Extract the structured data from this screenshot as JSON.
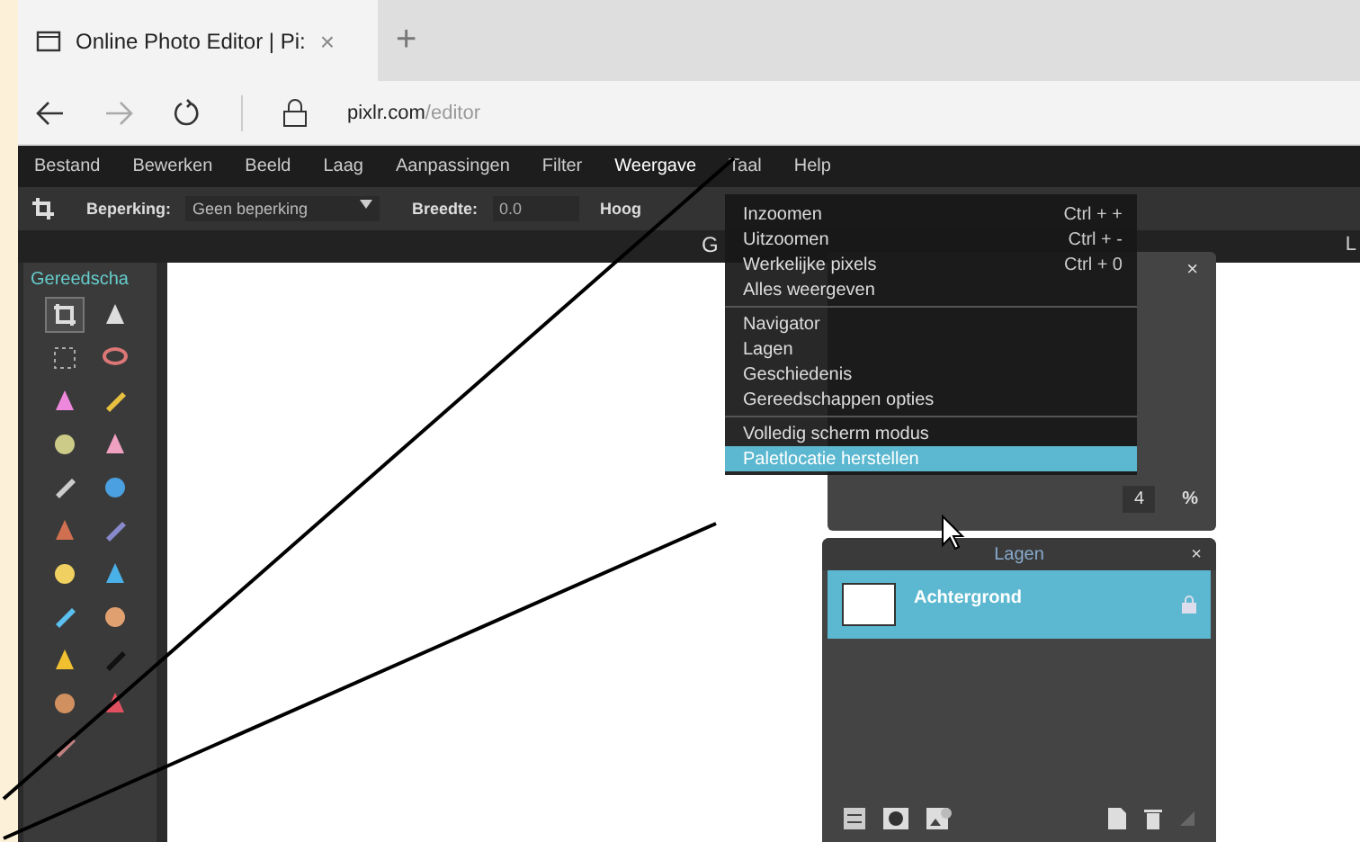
{
  "browser": {
    "tab_title": "Online Photo Editor | Pi:",
    "tab_close": "×",
    "new_tab": "+",
    "url_host": "pixlr.com",
    "url_path": "/editor"
  },
  "menu_bar": [
    {
      "label": "Bestand",
      "selected": false
    },
    {
      "label": "Bewerken",
      "selected": false
    },
    {
      "label": "Beeld",
      "selected": false
    },
    {
      "label": "Laag",
      "selected": false
    },
    {
      "label": "Aanpassingen",
      "selected": false
    },
    {
      "label": "Filter",
      "selected": false
    },
    {
      "label": "Weergave",
      "selected": true
    },
    {
      "label": "Taal",
      "selected": false
    },
    {
      "label": "Help",
      "selected": false
    }
  ],
  "toolbar": {
    "constraint_label": "Beperking:",
    "constraint_value": "Geen beperking",
    "width_label": "Breedte:",
    "width_value": "0.0",
    "height_label": "Hoog"
  },
  "tools_panel": {
    "title": "Gereedscha",
    "tools": [
      {
        "selected": true
      },
      {
        "selected": false
      },
      {
        "selected": false
      },
      {
        "selected": false
      },
      {
        "selected": false
      },
      {
        "selected": false
      },
      {
        "selected": false
      },
      {
        "selected": false
      },
      {
        "selected": false
      },
      {
        "selected": false
      },
      {
        "selected": false
      },
      {
        "selected": false
      },
      {
        "selected": false
      },
      {
        "selected": false
      },
      {
        "selected": false
      },
      {
        "selected": false
      },
      {
        "selected": false
      },
      {
        "selected": false
      },
      {
        "selected": false
      },
      {
        "selected": false
      },
      {
        "selected": false
      }
    ]
  },
  "canvas_title": "G",
  "right_panel_title": "L",
  "navigator": {
    "close": "×",
    "zoom_value": "4",
    "zoom_unit": "%"
  },
  "view_menu": {
    "groups": [
      [
        {
          "label": "Inzoomen",
          "shortcut": "Ctrl + +",
          "selected": false
        },
        {
          "label": "Uitzoomen",
          "shortcut": "Ctrl + -",
          "selected": false
        },
        {
          "label": "Werkelijke pixels",
          "shortcut": "Ctrl + 0",
          "selected": false
        },
        {
          "label": "Alles weergeven",
          "selected": false
        }
      ],
      [
        {
          "label": "Navigator",
          "selected": false
        },
        {
          "label": "Lagen",
          "selected": false
        },
        {
          "label": "Geschiedenis",
          "selected": false
        },
        {
          "label": "Gereedschappen opties",
          "selected": false
        }
      ],
      [
        {
          "label": "Volledig scherm modus",
          "selected": false
        },
        {
          "label": "Paletlocatie herstellen",
          "selected": true
        }
      ]
    ]
  },
  "layers_panel": {
    "title": "Lagen",
    "close": "×",
    "layers": [
      {
        "name": "Achtergrond",
        "selected": true,
        "locked": true
      }
    ]
  }
}
